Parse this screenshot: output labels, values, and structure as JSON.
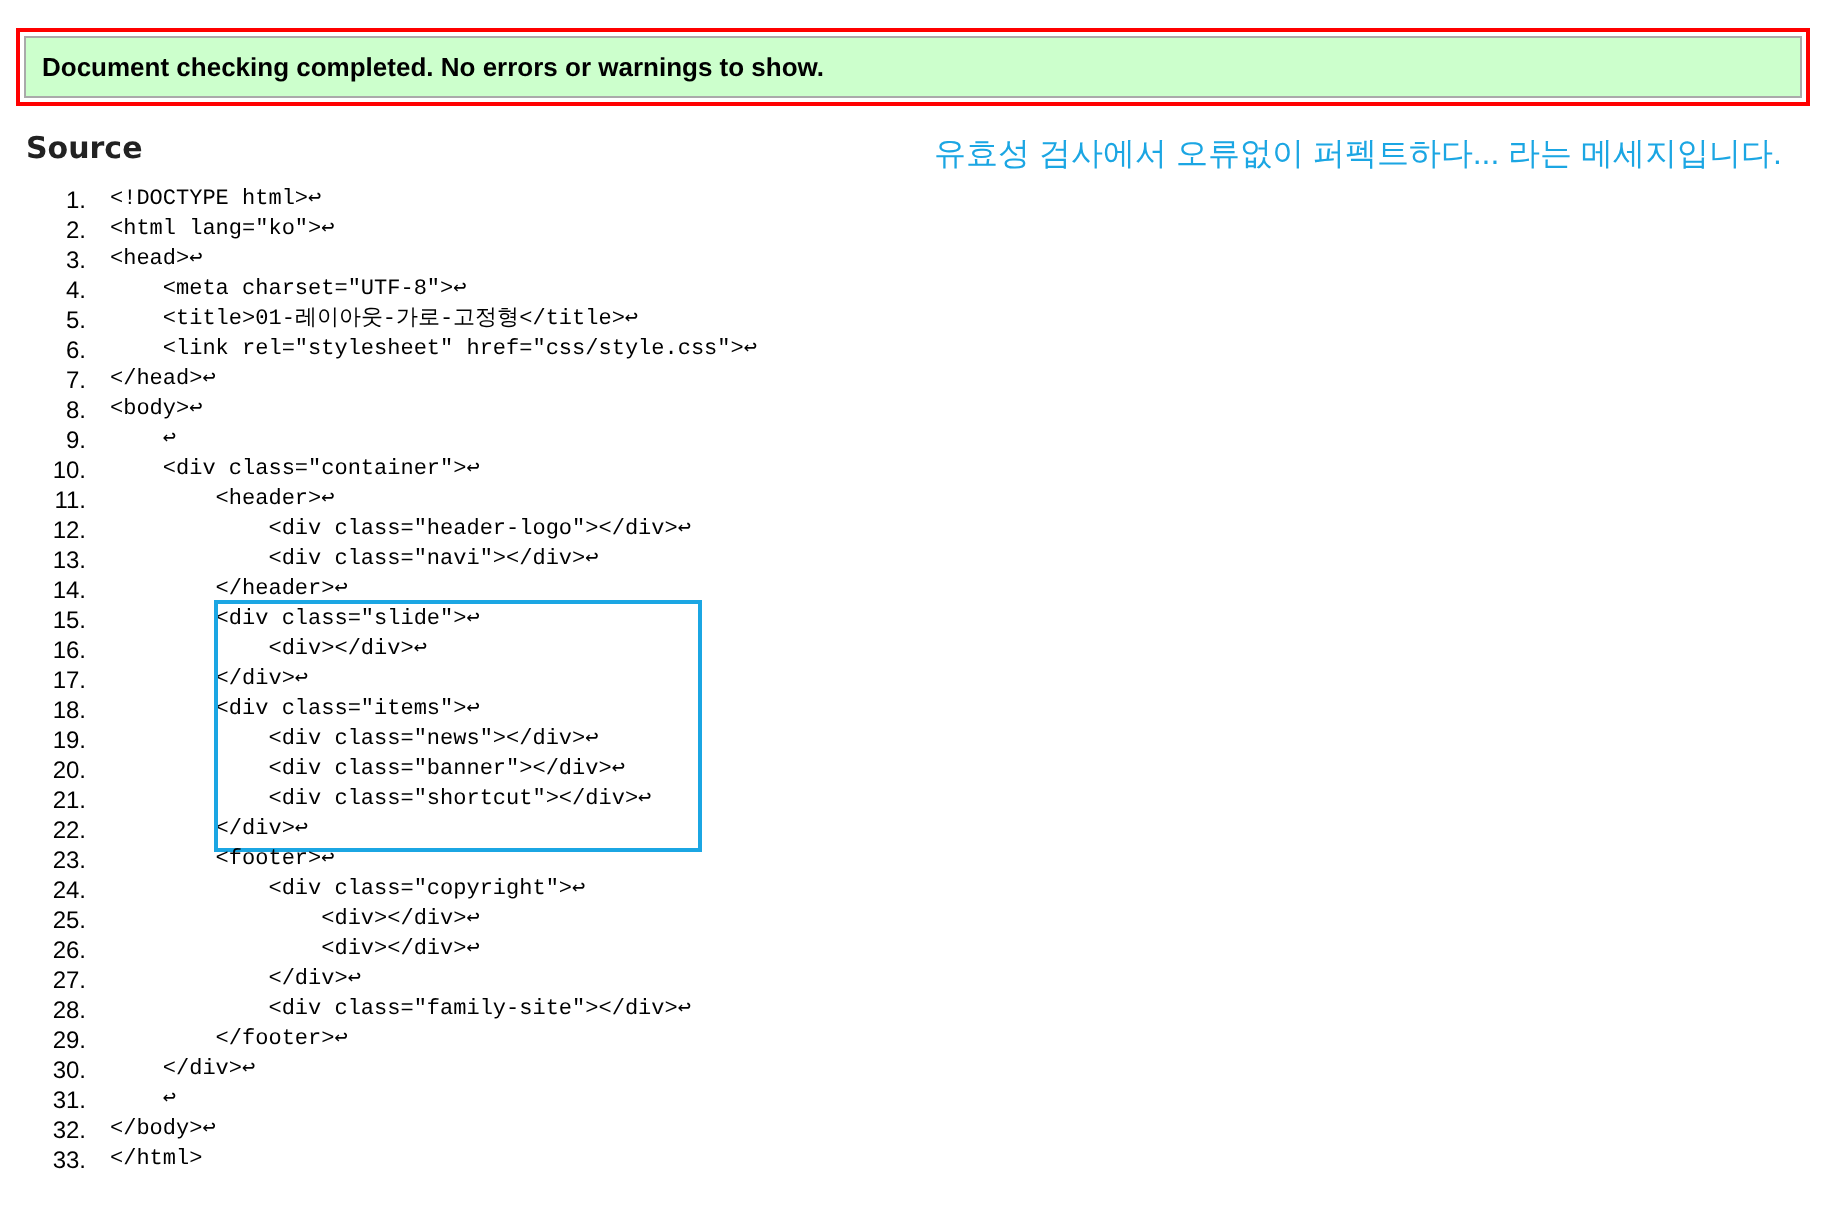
{
  "message": "Document checking completed. No errors or warnings to show.",
  "source_heading": "Source",
  "annotation": "유효성 검사에서 오류없이 퍼펙트하다... 라는 메세지입니다.",
  "source_lines": [
    {
      "number": "1.",
      "text": "<!DOCTYPE html>↩",
      "highlighted": false
    },
    {
      "number": "2.",
      "text": "<html lang=\"ko\">↩",
      "highlighted": false
    },
    {
      "number": "3.",
      "text": "<head>↩",
      "highlighted": false
    },
    {
      "number": "4.",
      "text": "    <meta charset=\"UTF-8\">↩",
      "highlighted": false
    },
    {
      "number": "5.",
      "text": "    <title>01-레이아웃-가로-고정형</title>↩",
      "highlighted": false
    },
    {
      "number": "6.",
      "text": "    <link rel=\"stylesheet\" href=\"css/style.css\">↩",
      "highlighted": false
    },
    {
      "number": "7.",
      "text": "</head>↩",
      "highlighted": false
    },
    {
      "number": "8.",
      "text": "<body>↩",
      "highlighted": false
    },
    {
      "number": "9.",
      "text": "    ↩",
      "highlighted": false
    },
    {
      "number": "10.",
      "text": "    <div class=\"container\">↩",
      "highlighted": false
    },
    {
      "number": "11.",
      "text": "        <header>↩",
      "highlighted": false
    },
    {
      "number": "12.",
      "text": "            <div class=\"header-logo\"></div>↩",
      "highlighted": false
    },
    {
      "number": "13.",
      "text": "            <div class=\"navi\"></div>↩",
      "highlighted": false
    },
    {
      "number": "14.",
      "text": "        </header>↩",
      "highlighted": false
    },
    {
      "number": "15.",
      "text": "        <div class=\"slide\">↩",
      "highlighted": true
    },
    {
      "number": "16.",
      "text": "            <div></div>↩",
      "highlighted": true
    },
    {
      "number": "17.",
      "text": "        </div>↩",
      "highlighted": true
    },
    {
      "number": "18.",
      "text": "        <div class=\"items\">↩",
      "highlighted": true
    },
    {
      "number": "19.",
      "text": "            <div class=\"news\"></div>↩",
      "highlighted": true
    },
    {
      "number": "20.",
      "text": "            <div class=\"banner\"></div>↩",
      "highlighted": true
    },
    {
      "number": "21.",
      "text": "            <div class=\"shortcut\"></div>↩",
      "highlighted": true
    },
    {
      "number": "22.",
      "text": "        </div>↩",
      "highlighted": true
    },
    {
      "number": "23.",
      "text": "        <footer>↩",
      "highlighted": false
    },
    {
      "number": "24.",
      "text": "            <div class=\"copyright\">↩",
      "highlighted": false
    },
    {
      "number": "25.",
      "text": "                <div></div>↩",
      "highlighted": false
    },
    {
      "number": "26.",
      "text": "                <div></div>↩",
      "highlighted": false
    },
    {
      "number": "27.",
      "text": "            </div>↩",
      "highlighted": false
    },
    {
      "number": "28.",
      "text": "            <div class=\"family-site\"></div>↩",
      "highlighted": false
    },
    {
      "number": "29.",
      "text": "        </footer>↩",
      "highlighted": false
    },
    {
      "number": "30.",
      "text": "    </div>↩",
      "highlighted": false
    },
    {
      "number": "31.",
      "text": "    ↩",
      "highlighted": false
    },
    {
      "number": "32.",
      "text": "</body>↩",
      "highlighted": false
    },
    {
      "number": "33.",
      "text": "</html>",
      "highlighted": false
    }
  ]
}
